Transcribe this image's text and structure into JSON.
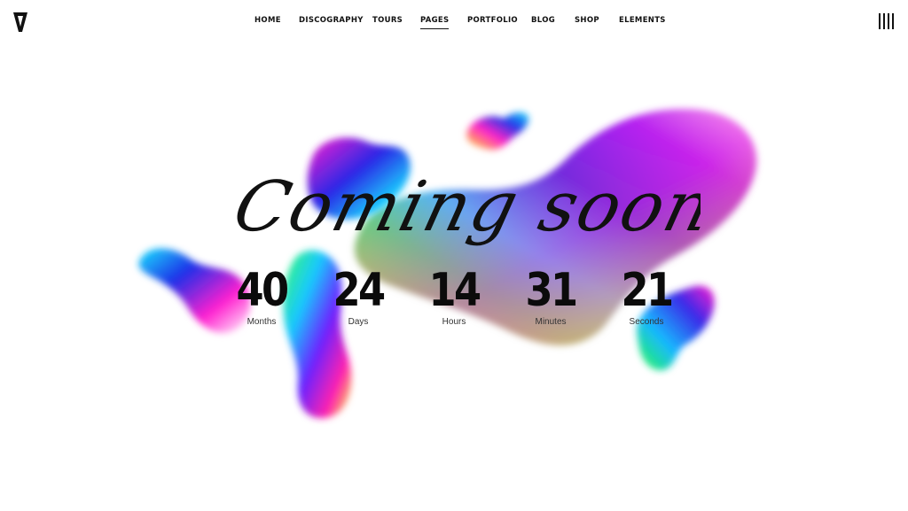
{
  "brand": {
    "logo_letter": "V"
  },
  "nav": {
    "items": [
      {
        "label": "HOME",
        "active": false
      },
      {
        "label": "DISCOGRAPHY",
        "active": false
      },
      {
        "label": "TOURS",
        "active": false
      },
      {
        "label": "PAGES",
        "active": true
      },
      {
        "label": "PORTFOLIO",
        "active": false
      },
      {
        "label": "BLOG",
        "active": false
      },
      {
        "label": "SHOP",
        "active": false
      },
      {
        "label": "ELEMENTS",
        "active": false
      }
    ],
    "menu_icon": "hamburger-bars-icon"
  },
  "hero": {
    "title": "Coming soon",
    "countdown": [
      {
        "value": "40",
        "label": "Months"
      },
      {
        "value": "24",
        "label": "Days"
      },
      {
        "value": "14",
        "label": "Hours"
      },
      {
        "value": "31",
        "label": "Minutes"
      },
      {
        "value": "21",
        "label": "Seconds"
      }
    ]
  },
  "colors": {
    "text": "#111111",
    "background": "#ffffff",
    "gradient_blue": "#1f2bd9",
    "gradient_magenta": "#ff1fd2",
    "gradient_yellow": "#f5ff1a",
    "gradient_cyan": "#19f0ff",
    "gradient_green": "#1aff5a"
  }
}
